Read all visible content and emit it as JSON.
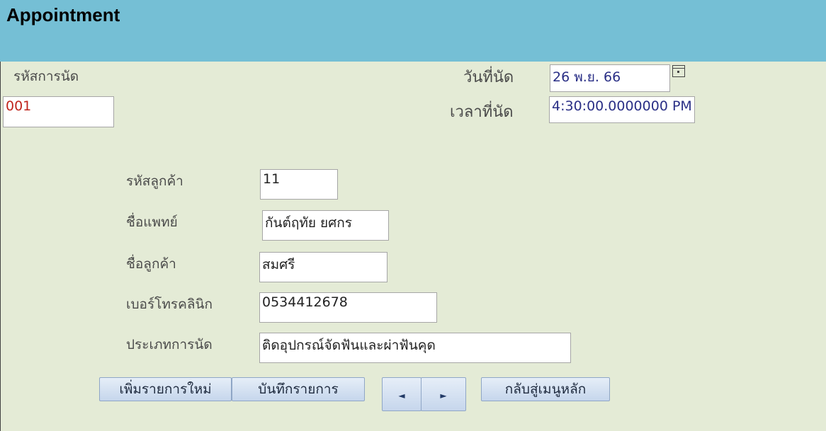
{
  "header": {
    "title": "Appointment"
  },
  "form": {
    "appointment_id_label": "รหัสการนัด",
    "appointment_id": "001",
    "date_label": "วันที่นัด",
    "date_value": "26 พ.ย. 66",
    "time_label": "เวลาที่นัด",
    "time_value": "4:30:00.0000000 PM",
    "customer_id_label": "รหัสลูกค้า",
    "customer_id": "11",
    "doctor_name_label": "ชื่อแพทย์",
    "doctor_name": "กันต์ฤทัย ยศกร",
    "customer_name_label": "ชื่อลูกค้า",
    "customer_name": "สมศรี",
    "clinic_phone_label": "เบอร์โทรคลินิก",
    "clinic_phone": "0534412678",
    "appointment_type_label": "ประเภทการนัด",
    "appointment_type": "ติดอุปกรณ์จัดฟันและผ่าฟันคุด"
  },
  "buttons": {
    "add_new": "เพิ่มรายการใหม่",
    "save": "บันทึกรายการ",
    "prev": "◄",
    "next": "►",
    "back_to_menu": "กลับสู่เมนูหลัก"
  },
  "icons": {
    "calendar": "calendar-icon"
  },
  "colors": {
    "header": "#75bfd5",
    "background": "#e4ebd6",
    "id_text": "#c0251d",
    "date_text": "#2a2f86"
  }
}
